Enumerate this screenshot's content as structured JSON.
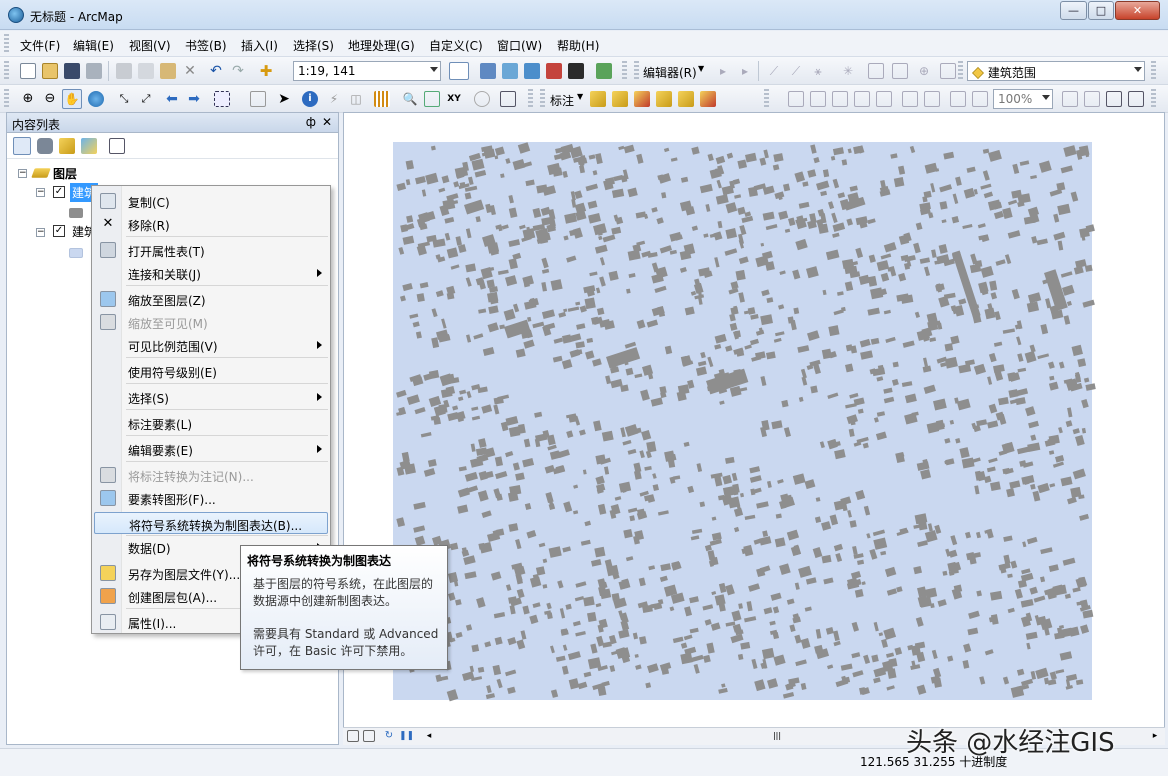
{
  "window": {
    "title": "无标题 - ArcMap",
    "min": "—",
    "max": "□",
    "close": "✕"
  },
  "menu": [
    "文件(F)",
    "编辑(E)",
    "视图(V)",
    "书签(B)",
    "插入(I)",
    "选择(S)",
    "地理处理(G)",
    "自定义(C)",
    "窗口(W)",
    "帮助(H)"
  ],
  "toolbar1": {
    "scale": "1:19, 141",
    "editor": "编辑器(R)",
    "target_layer": "建筑范围"
  },
  "toolbar2": {
    "label_menu": "标注",
    "zoom": "100%"
  },
  "toc": {
    "title": "内容列表",
    "pin": "ф",
    "close": "✕",
    "root": "图层",
    "layer1": "建筑",
    "layer2": "建筑"
  },
  "context_menu": [
    {
      "label": "复制(C)",
      "icon": "copy-icon",
      "enabled": true
    },
    {
      "label": "移除(R)",
      "icon": "remove-icon",
      "enabled": true
    },
    {
      "label": "打开属性表(T)",
      "icon": "table-icon",
      "enabled": true
    },
    {
      "label": "连接和关联(J)",
      "submenu": true,
      "enabled": true
    },
    {
      "label": "缩放至图层(Z)",
      "icon": "zoom-to-layer-icon",
      "enabled": true
    },
    {
      "label": "缩放至可见(M)",
      "icon": "zoom-visible-icon",
      "enabled": false
    },
    {
      "label": "可见比例范围(V)",
      "submenu": true,
      "enabled": true
    },
    {
      "label": "使用符号级别(E)",
      "enabled": true
    },
    {
      "label": "选择(S)",
      "submenu": true,
      "enabled": true
    },
    {
      "label": "标注要素(L)",
      "enabled": true
    },
    {
      "label": "编辑要素(E)",
      "submenu": true,
      "enabled": true
    },
    {
      "label": "将标注转换为注记(N)...",
      "icon": "convert-labels-icon",
      "enabled": false
    },
    {
      "label": "要素转图形(F)...",
      "icon": "features-to-graphics-icon",
      "enabled": true
    },
    {
      "label": "将符号系统转换为制图表达(B)...",
      "enabled": true,
      "highlighted": true
    },
    {
      "label": "数据(D)",
      "submenu": true,
      "enabled": true
    },
    {
      "label": "另存为图层文件(Y)...",
      "icon": "layer-file-icon",
      "enabled": true
    },
    {
      "label": "创建图层包(A)...",
      "icon": "layer-package-icon",
      "enabled": true
    },
    {
      "label": "属性(I)...",
      "icon": "properties-icon",
      "enabled": true
    }
  ],
  "tooltip": {
    "title": "将符号系统转换为制图表达",
    "line1": "基于图层的符号系统，在此图层的",
    "line2": "数据源中创建新制图表达。",
    "line3": "需要具有 Standard 或 Advanced",
    "line4": "许可，在 Basic 许可下禁用。"
  },
  "status": {
    "coords": "121.565  31.255 十进制度"
  },
  "watermark": "头条 @水经注GIS",
  "colors": {
    "map_bg": "#cad8f0",
    "building": "#8e8e8e",
    "highlight": "#d6e8fb"
  }
}
